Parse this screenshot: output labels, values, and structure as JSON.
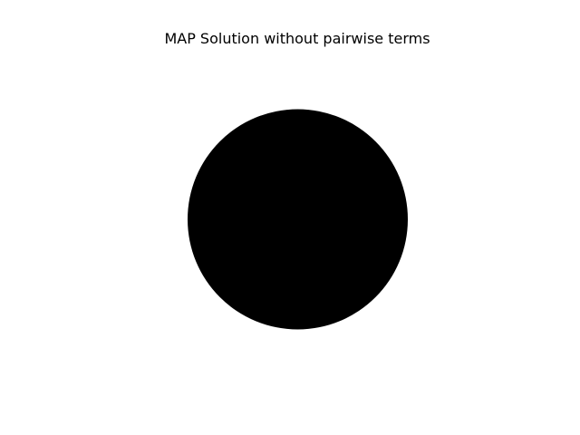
{
  "figure": {
    "title": "MAP Solution without pairwise terms"
  },
  "image": {
    "background_color": "#ffffff",
    "shape": "filled-circle",
    "fill_color": "#000000"
  }
}
